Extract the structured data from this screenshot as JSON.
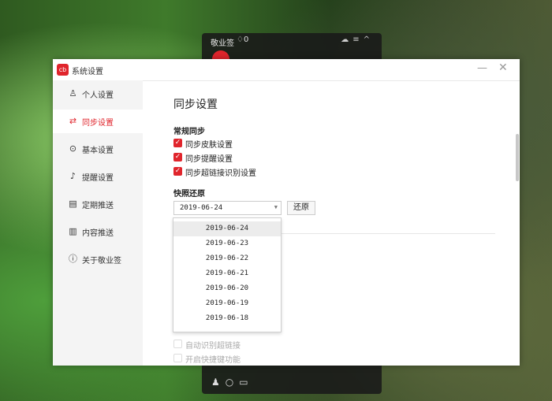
{
  "background_widget": {
    "title": "敬业签",
    "bell_count": "0",
    "top_icons": [
      "cloud-icon",
      "menu-icon",
      "collapse-icon"
    ],
    "bottom_icons": [
      "users-icon",
      "search-icon",
      "note-icon"
    ]
  },
  "window": {
    "title": "系统设置",
    "logo_text": "cb",
    "minimize": "—",
    "close": "✕"
  },
  "sidebar": {
    "items": [
      {
        "label": "个人设置",
        "icon": "person-icon",
        "glyph": "♙",
        "active": false
      },
      {
        "label": "同步设置",
        "icon": "sync-icon",
        "glyph": "⇄",
        "active": true
      },
      {
        "label": "基本设置",
        "icon": "settings-icon",
        "glyph": "⊙",
        "active": false
      },
      {
        "label": "提醒设置",
        "icon": "bell-icon",
        "glyph": "♪",
        "active": false
      },
      {
        "label": "定期推送",
        "icon": "calendar-icon",
        "glyph": "▤",
        "active": false
      },
      {
        "label": "内容推送",
        "icon": "content-icon",
        "glyph": "▥",
        "active": false
      },
      {
        "label": "关于敬业签",
        "icon": "info-icon",
        "glyph": "ⓘ",
        "active": false
      }
    ]
  },
  "content": {
    "page_title": "同步设置",
    "general_sync": {
      "title": "常规同步",
      "options": [
        {
          "label": "同步皮肤设置",
          "checked": true
        },
        {
          "label": "同步提醒设置",
          "checked": true
        },
        {
          "label": "同步超链接识别设置",
          "checked": true
        }
      ]
    },
    "snapshot": {
      "title": "快照还原",
      "selected_date": "2019-06-24",
      "restore_label": "还原",
      "dates": [
        "2019-06-24",
        "2019-06-23",
        "2019-06-22",
        "2019-06-21",
        "2019-06-20",
        "2019-06-19",
        "2019-06-18"
      ]
    },
    "lower_options": [
      {
        "label": "自动识别超链接",
        "checked": false
      },
      {
        "label": "开启快捷键功能",
        "checked": false
      }
    ]
  }
}
